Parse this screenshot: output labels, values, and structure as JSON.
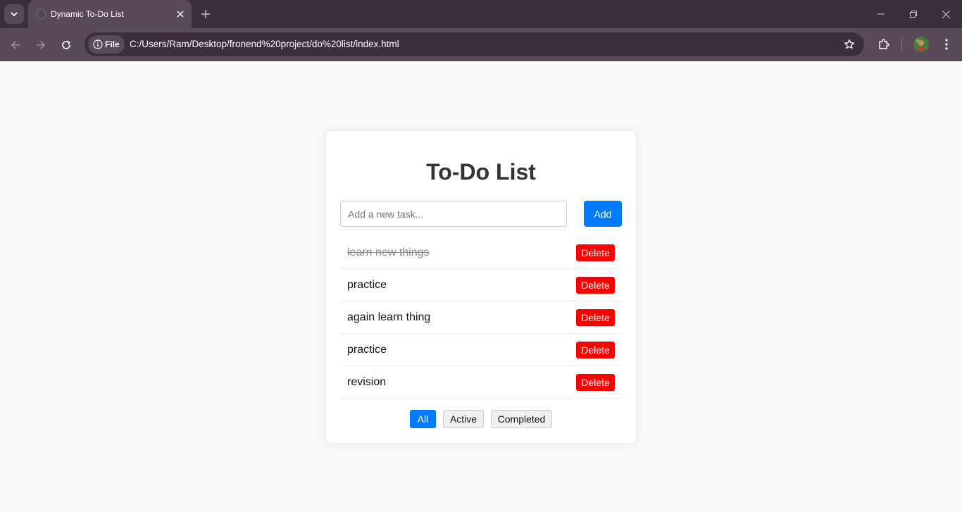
{
  "browser": {
    "tab_title": "Dynamic To-Do List",
    "address_chip": "File",
    "url": "C:/Users/Ram/Desktop/fronend%20project/do%20list/index.html"
  },
  "colors": {
    "accent": "#007bff",
    "danger": "#ff0000",
    "chrome_dark": "#3c2f3b",
    "chrome_light": "#5a4958"
  },
  "app": {
    "title": "To-Do List",
    "input_placeholder": "Add a new task...",
    "add_label": "Add",
    "delete_label": "Delete",
    "tasks": [
      {
        "text": "learn new things",
        "completed": true
      },
      {
        "text": "practice",
        "completed": false
      },
      {
        "text": "again learn thing",
        "completed": false
      },
      {
        "text": "practice",
        "completed": false
      },
      {
        "text": "revision",
        "completed": false
      }
    ],
    "filters": [
      {
        "label": "All",
        "active": true
      },
      {
        "label": "Active",
        "active": false
      },
      {
        "label": "Completed",
        "active": false
      }
    ]
  }
}
